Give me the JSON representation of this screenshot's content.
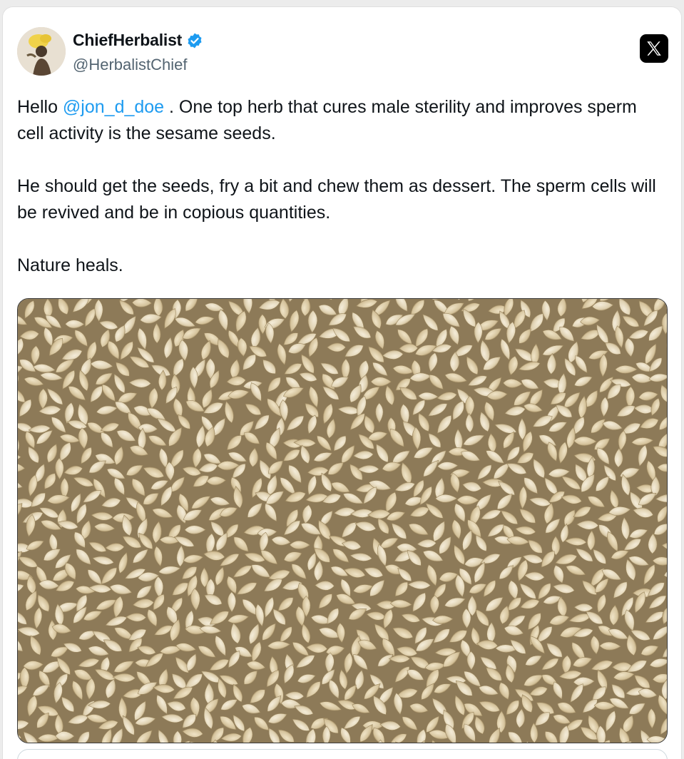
{
  "author": {
    "display_name": "ChiefHerbalist",
    "handle": "@HerbalistChief",
    "verified": true
  },
  "icons": {
    "verified": "verified-badge-icon",
    "platform": "x-logo-icon"
  },
  "tweet": {
    "greeting": "Hello ",
    "mention": "@jon_d_doe",
    "line1_rest": " . One top herb that cures male sterility and improves sperm cell activity is the sesame seeds.",
    "paragraph2": "He should get the seeds, fry a bit and chew them as dessert. The sperm cells will be revived and be in copious quantities.",
    "paragraph3": "Nature heals."
  },
  "colors": {
    "mention": "#1d9bf0",
    "verified": "#1d9bf0",
    "text": "#0f1419",
    "handle": "#536471"
  }
}
